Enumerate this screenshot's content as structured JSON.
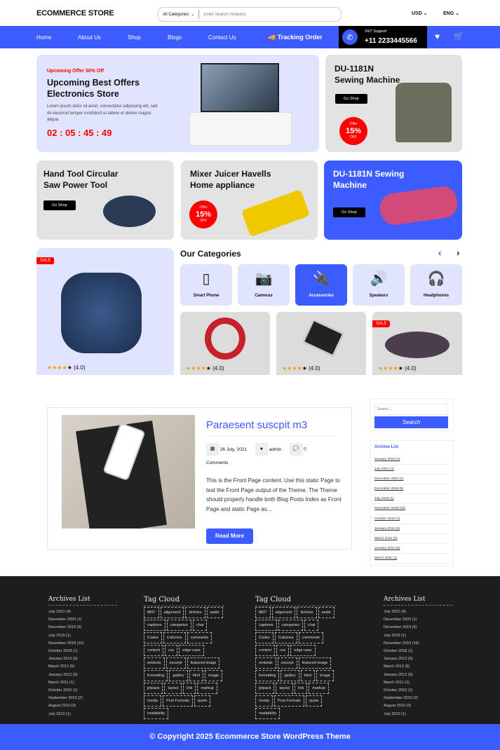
{
  "header": {
    "logo": "ECOMMERCE STORE",
    "category_select": "All Categories",
    "search_placeholder": "Enter Search Products",
    "currency": "USD",
    "language": "ENG"
  },
  "nav": {
    "items": [
      "Home",
      "About Us",
      "Shop",
      "Blogs",
      "Contact Us"
    ],
    "tracking": "Tracking Order",
    "support_label": "24/7 Support",
    "support_phone": "+11 2233445566"
  },
  "hero": {
    "tag": "Upcoming Offer 30% Off",
    "title": "Upcoming Best Offers Electronics Store",
    "text": "Lorem ipsum dolor sit amet, consectetur adipiscing elit, sed do eiusmod tempor incididunt ut labore et dolore magna aliqua.",
    "countdown": "02 : 05 : 45 : 49"
  },
  "promo": [
    {
      "title": "DU-1181N Sewing Machine",
      "button": "Go Shop",
      "offer": "Offer",
      "pct": "15%",
      "off": "OFF"
    },
    {
      "title": "Hand Tool Circular Saw Power Tool",
      "button": "Go Shop"
    },
    {
      "title": "Mixer Juicer Havells Home appliance",
      "offer": "Offer",
      "pct": "15%",
      "off": "OFF"
    },
    {
      "title": "DU-1181N Sewing Machine",
      "button": "Go Shop"
    }
  ],
  "featured": {
    "badge": "SALE",
    "rating": "(4.0)",
    "stars": 4
  },
  "categories": {
    "title": "Our Categories",
    "items": [
      "Smart Phone",
      "Cameras",
      "Accessories",
      "Speakers",
      "Headphones"
    ],
    "active": "Accessories"
  },
  "products": [
    {
      "rating": "(4.0)",
      "stars": 4
    },
    {
      "rating": "(4.0)",
      "stars": 4
    },
    {
      "badge": "SALE",
      "rating": "(4.0)",
      "stars": 4
    }
  ],
  "post": {
    "title": "Paraesent suscpit m3",
    "date": "26 July, 2021",
    "author": "admin",
    "comments": "0",
    "comments_label": "Comments",
    "excerpt": "This is the Front Page content. Use this static Page to test the Front Page output of the Theme. The Theme should properly handle both Blog Posts Index as Front Page and static Page as...",
    "button": "Read More"
  },
  "sidebar": {
    "search_placeholder": "Search ...",
    "search_button": "Search",
    "archive_title": "Archive List",
    "archives": [
      "January 2023 (7)",
      "July 2021 (4)",
      "December 2020 (1)",
      "December 2019 (5)",
      "July 2019 (1)",
      "November 2018 (15)",
      "October 2018 (1)",
      "January 2013 (6)",
      "March 2012 (5)",
      "January 2012 (6)",
      "March 2011 (1)"
    ]
  },
  "footer": {
    "archives_title": "Archives List",
    "archives": [
      "July 2021 (4)",
      "December 2020 (1)",
      "December 2019 (5)",
      "July 2019 (1)",
      "November 2018 (15)",
      "October 2018 (1)",
      "January 2013 (5)",
      "March 2012 (5)",
      "January 2012 (6)",
      "March 2011 (1)",
      "October 2010 (1)",
      "September 2010 (2)",
      "August 2010 (3)",
      "July 2010 (1)"
    ],
    "tag_title": "Tag Cloud",
    "tags": [
      "8BIT",
      "alignment",
      "Articles",
      "aside",
      "captions",
      "categories",
      "chat",
      "Codex",
      "Columns",
      "comments",
      "content",
      "css",
      "edge case",
      "embeds",
      "excerpt",
      "featured image",
      "formatting",
      "gallery",
      "html",
      "image",
      "jetpack",
      "layout",
      "link",
      "markup",
      "media",
      "Post Formats",
      "quote",
      "readability"
    ]
  },
  "copyright": "© Copyright 2025 Ecommerce Store WordPress Theme",
  "colors": {
    "primary": "#3d5cff",
    "accent_red": "#ff0000",
    "footer_bg": "#1d1d1f",
    "card_lavender": "#e1e4ff"
  }
}
